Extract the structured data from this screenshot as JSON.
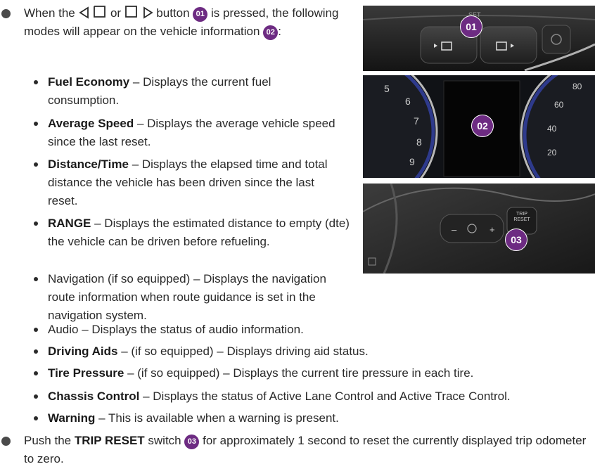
{
  "intro": {
    "part1": "When the",
    "or": "or",
    "part2": "button",
    "part3": "is pressed, the following modes will appear on the vehicle information",
    "part4": ":"
  },
  "badges": {
    "b1": "01",
    "b2": "02",
    "b3": "03"
  },
  "modes": [
    {
      "bold": "Fuel Economy",
      "text": " – Displays the current fuel consumption."
    },
    {
      "bold": "Average Speed",
      "text": " – Displays the average vehicle speed since the last reset."
    },
    {
      "bold": "Distance/Time",
      "text": " – Displays the elapsed time and total distance the vehicle has been driven since the last reset."
    },
    {
      "bold": "RANGE",
      "text": " – Displays the estimated distance to empty (dte) the vehicle can be driven before refueling."
    },
    {
      "bold": "",
      "text": "Navigation (if so equipped) – Displays the navigation route information when route guidance is set in the navigation system."
    },
    {
      "bold": "",
      "text": "Audio – Displays the status of audio information."
    },
    {
      "bold": "Driving Aids",
      "text": " – (if so equipped) – Displays driving aid status."
    },
    {
      "bold": "Tire Pressure",
      "text": " – (if so equipped) – Displays the current tire pressure in each tire."
    },
    {
      "bold": "Chassis Control",
      "text": " – Displays the status of Active Lane Control and Active Trace Control."
    },
    {
      "bold": "Warning",
      "text": " – This is available when a warning is present."
    }
  ],
  "reset": {
    "part1": "Push the",
    "bold": "TRIP RESET",
    "part2": "switch",
    "part3": "for approximately 1 second to reset the currently displayed trip odometer to zero."
  },
  "photo_labels": {
    "set": "SET",
    "trip_reset": "TRIP RESET",
    "gauge_left": [
      "5",
      "6",
      "7",
      "8",
      "9"
    ],
    "gauge_right": [
      "80",
      "60",
      "40",
      "20"
    ]
  }
}
